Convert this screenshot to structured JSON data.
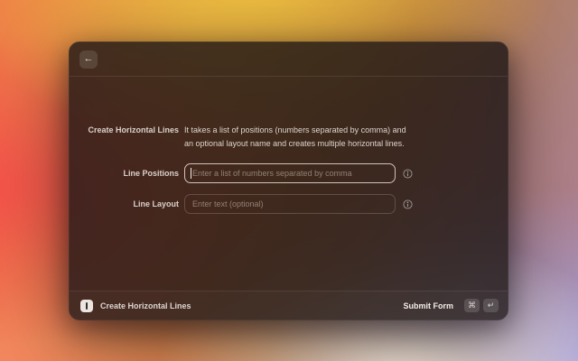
{
  "window": {
    "header": {
      "back_icon": "←"
    },
    "form": {
      "title_label": "Create Horizontal Lines",
      "description": "It takes a list of positions (numbers separated by comma) and an optional layout name and creates multiple horizontal lines.",
      "fields": [
        {
          "label": "Line Positions",
          "placeholder": "Enter a list of numbers separated by comma",
          "value": "",
          "focused": true
        },
        {
          "label": "Line Layout",
          "placeholder": "Enter text (optional)",
          "value": "",
          "focused": false
        }
      ]
    },
    "footer": {
      "command_name": "Create Horizontal Lines",
      "primary_action_label": "Submit Form",
      "shortcut_keys": [
        "⌘",
        "↵"
      ]
    }
  },
  "colors": {
    "window_tint": "rgba(25,20,22,0.8)",
    "focused_field_border": "rgba(255,248,240,0.75)",
    "background_orange": "#ef7a48",
    "background_yellow": "#eec43e",
    "background_red": "#f44c4a",
    "background_lavender": "#a09bdc",
    "background_cream": "#faf0dd"
  }
}
